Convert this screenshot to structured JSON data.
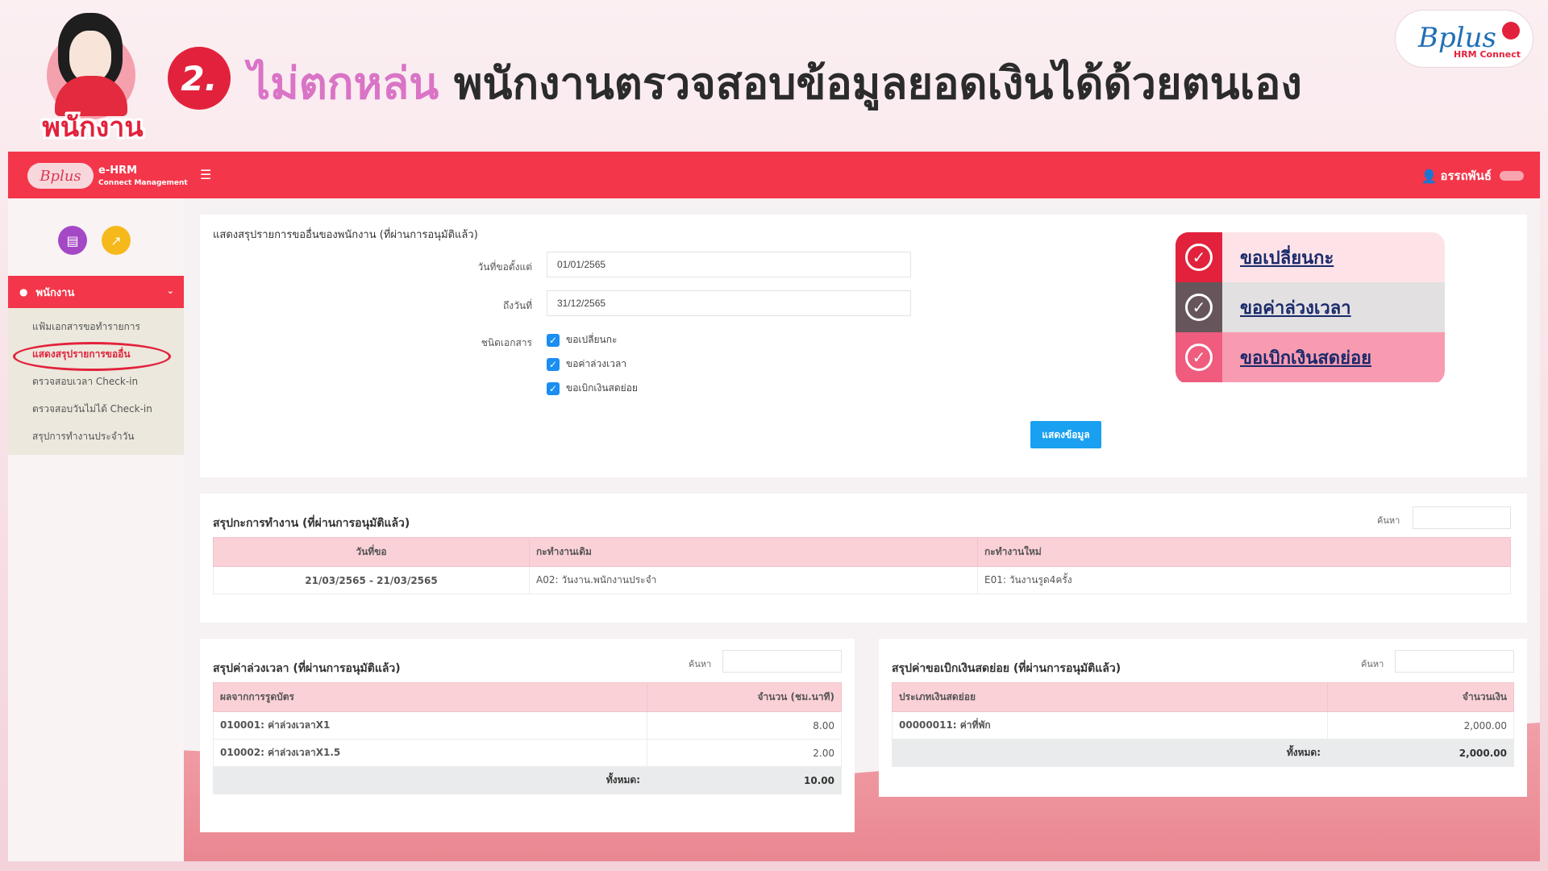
{
  "banner": {
    "avatar_label": "พนักงาน",
    "step_number": "2.",
    "headline_highlight": "ไม่ตกหล่น",
    "headline_rest": "พนักงานตรวจสอบข้อมูลยอดเงินได้ด้วยตนเอง",
    "brand_script": "Bplus",
    "brand_sub": "HRM Connect"
  },
  "topbar": {
    "logo": "Bplus",
    "app_title": "e-HRM",
    "app_subtitle": "Connect Management",
    "menu_icon": "hamburger-icon",
    "user_name": "อรรถพันธ์"
  },
  "sidebar": {
    "group_label": "พนักงาน",
    "items": [
      {
        "label": "แฟ้มเอกสารขอทำรายการ"
      },
      {
        "label": "แสดงสรุปรายการขออื่น"
      },
      {
        "label": "ตรวจสอบเวลา Check-in"
      },
      {
        "label": "ตรวจสอบวันไม่ได้ Check-in"
      },
      {
        "label": "สรุปการทำงานประจำวัน"
      }
    ]
  },
  "filter": {
    "title": "แสดงสรุปรายการขออื่นของพนักงาน (ที่ผ่านการอนุมัติแล้ว)",
    "from_label": "วันที่ขอตั้งแต่",
    "from_value": "01/01/2565",
    "to_label": "ถึงวันที่",
    "to_value": "31/12/2565",
    "doctype_label": "ชนิดเอกสาร",
    "options": [
      "ขอเปลี่ยนกะ",
      "ขอค่าล่วงเวลา",
      "ขอเบิกเงินสดย่อย"
    ],
    "show_button": "แสดงข้อมูล"
  },
  "legend": {
    "items": [
      "ขอเปลี่ยนกะ",
      "ขอค่าล่วงเวลา",
      "ขอเบิกเงินสดย่อย"
    ],
    "colors": [
      "#e2223c",
      "#66565b",
      "#ef5c7e"
    ]
  },
  "shift": {
    "title": "สรุปกะการทำงาน (ที่ผ่านการอนุมัติแล้ว)",
    "search_label": "ค้นหา",
    "headers": [
      "วันที่ขอ",
      "กะทำงานเดิม",
      "กะทำงานใหม่"
    ],
    "rows": [
      [
        "21/03/2565 - 21/03/2565",
        "A02: วันงาน.พนักงานประจำ",
        "E01: วันงานรูด4ครั้ง"
      ]
    ]
  },
  "ot": {
    "title": "สรุปค่าล่วงเวลา (ที่ผ่านการอนุมัติแล้ว)",
    "search_label": "ค้นหา",
    "headers": [
      "ผลจากการรูดบัตร",
      "จำนวน (ชม.นาที)"
    ],
    "rows": [
      [
        "010001: ค่าล่วงเวลาX1",
        "8.00"
      ],
      [
        "010002: ค่าล่วงเวลาX1.5",
        "2.00"
      ]
    ],
    "total_label": "ทั้งหมด:",
    "total_value": "10.00"
  },
  "cash": {
    "title": "สรุปค่าขอเบิกเงินสดย่อย (ที่ผ่านการอนุมัติแล้ว)",
    "search_label": "ค้นหา",
    "headers": [
      "ประเภทเงินสดย่อย",
      "จำนวนเงิน"
    ],
    "rows": [
      [
        "00000011: ค่าที่พัก",
        "2,000.00"
      ]
    ],
    "total_label": "ทั้งหมด:",
    "total_value": "2,000.00"
  }
}
